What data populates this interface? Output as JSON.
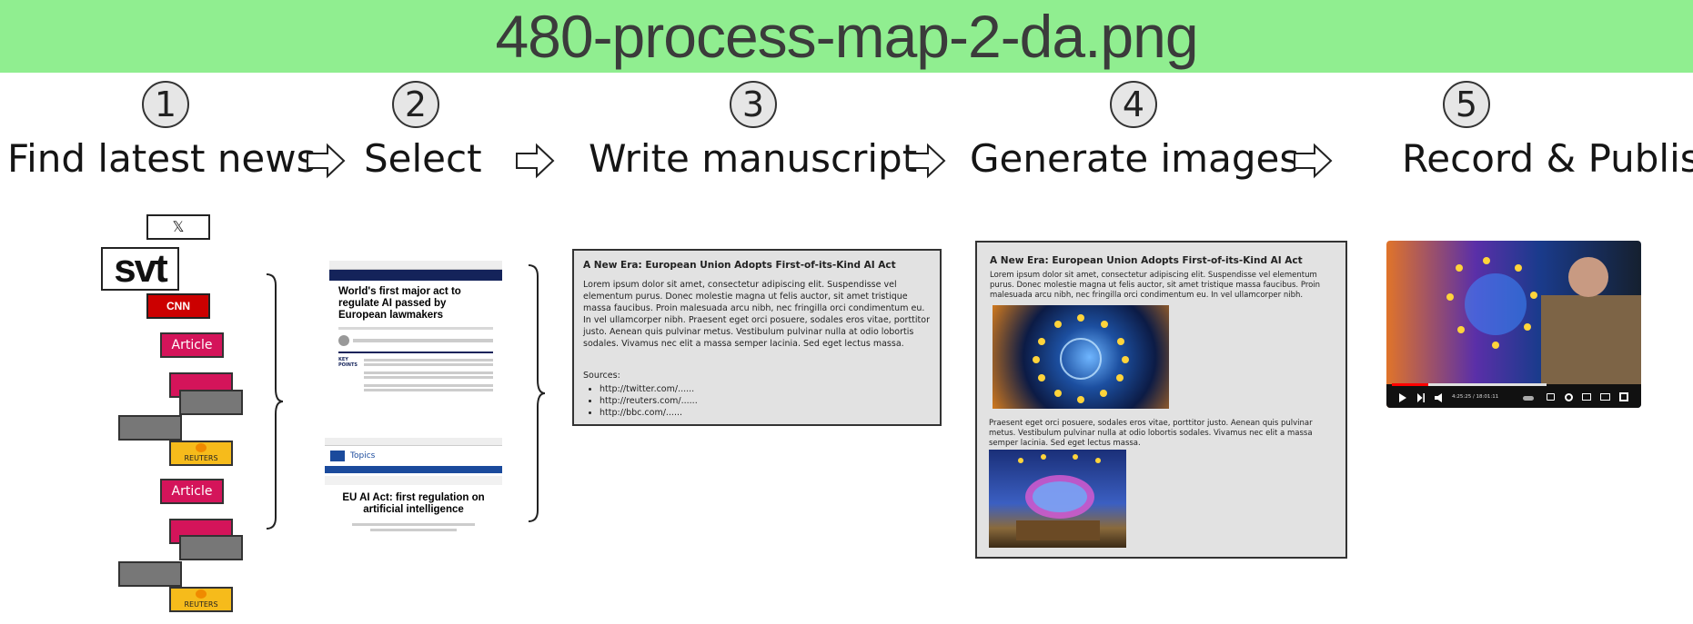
{
  "title": "480-process-map-2-da.png",
  "steps": [
    {
      "number": "1",
      "label": "Find latest news"
    },
    {
      "number": "2",
      "label": "Select"
    },
    {
      "number": "3",
      "label": "Write manuscript"
    },
    {
      "number": "4",
      "label": "Generate images"
    },
    {
      "number": "5",
      "label": "Record & Publish"
    }
  ],
  "sources": {
    "x_label": "𝕏",
    "svt_label": "svt",
    "cnn_label": "CNN",
    "article_label": "Article",
    "reuters_label": "REUTERS"
  },
  "selected": {
    "article1_title": "World's first major act to regulate AI passed by European lawmakers",
    "article1_keypoints": "KEY POINTS",
    "article2_topics": "Topics",
    "article2_title": "EU AI Act: first regulation on artificial intelligence"
  },
  "manuscript": {
    "title": "A New Era: European Union Adopts First-of-its-Kind AI Act",
    "body": "Lorem ipsum dolor sit amet, consectetur adipiscing elit. Suspendisse vel elementum purus. Donec molestie magna ut felis auctor, sit amet tristique massa faucibus. Proin malesuada arcu nibh, nec fringilla orci condimentum eu. In vel ullamcorper nibh. Praesent eget orci posuere, sodales eros vitae, porttitor justo. Aenean quis pulvinar metus. Vestibulum pulvinar nulla at odio lobortis sodales. Vivamus nec elit a massa semper lacinia. Sed eget lectus massa.",
    "sources_label": "Sources:",
    "sources": [
      "http://twitter.com/......",
      "http://reuters.com/......",
      "http://bbc.com/......"
    ]
  },
  "images_doc": {
    "title": "A New Era: European Union Adopts First-of-its-Kind AI Act",
    "para1": "Lorem ipsum dolor sit amet, consectetur adipiscing elit. Suspendisse vel elementum purus. Donec molestie magna ut felis auctor, sit amet tristique massa faucibus. Proin malesuada arcu nibh, nec fringilla orci condimentum eu. In vel ullamcorper nibh.",
    "para2": "Praesent eget orci posuere, sodales eros vitae, porttitor justo. Aenean quis pulvinar metus. Vestibulum pulvinar nulla at odio lobortis sodales. Vivamus nec elit a massa semper lacinia. Sed eget lectus massa."
  },
  "video": {
    "time": "4:25:25 / 18:01:11"
  },
  "colors": {
    "banner": "#90ee90",
    "article": "#d4145a",
    "reuters": "#f6bb1b",
    "cnn": "#cc0000"
  }
}
